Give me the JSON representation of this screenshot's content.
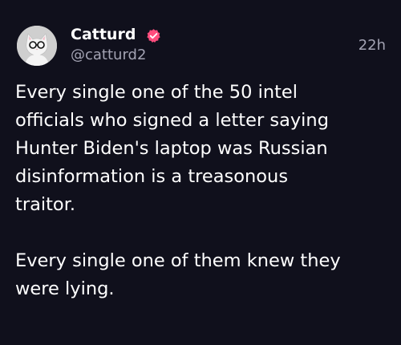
{
  "post": {
    "author": {
      "display_name": "Catturd",
      "handle": "@catturd2",
      "verified": true,
      "verified_color": "#ff4d7d",
      "avatar_icon": "cat-with-glasses-avatar"
    },
    "timestamp": "22h",
    "paragraphs": [
      {
        "lines": [
          "Every single one of the 50 intel",
          "officials who signed a letter saying",
          "Hunter Biden's laptop was Russian",
          "disinformation is a treasonous",
          "traitor."
        ]
      },
      {
        "lines": [
          "Every single one of them knew they",
          "were lying."
        ]
      }
    ]
  },
  "theme": {
    "background": "#10101c",
    "text_primary": "#ffffff",
    "text_secondary": "#a3a3b3"
  }
}
